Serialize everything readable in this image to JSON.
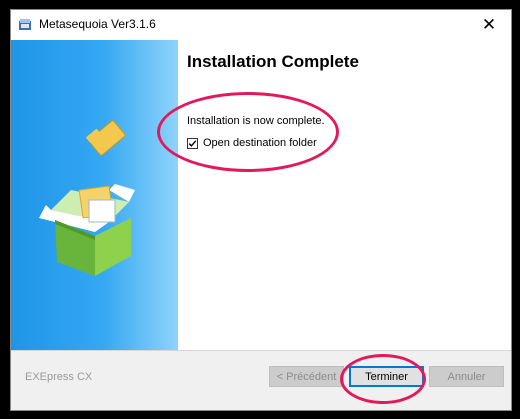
{
  "window": {
    "title": "Metasequoia Ver3.1.6",
    "close_glyph": "✕"
  },
  "main": {
    "heading": "Installation Complete",
    "status": "Installation is now complete.",
    "open_folder": {
      "label": "Open destination folder",
      "checked": true
    }
  },
  "footer": {
    "brand": "EXEpress CX",
    "back_label": "< Précédent",
    "finish_label": "Terminer",
    "cancel_label": "Annuler"
  },
  "icons": {
    "app": "installer-icon",
    "side_graphic": "open-box-with-folder-icon"
  },
  "colors": {
    "annotation": "#e21a5d",
    "side_panel": "#2a9ff0",
    "accent": "#0078d7"
  }
}
